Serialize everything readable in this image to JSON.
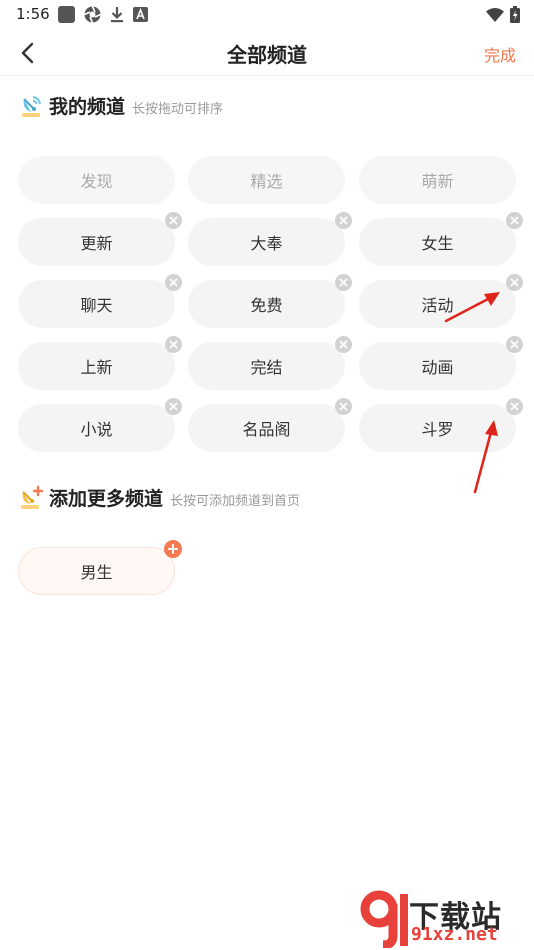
{
  "status": {
    "time": "1:56",
    "left_icons": [
      "app-square-icon",
      "aperture-icon",
      "download-icon",
      "a-box-icon"
    ],
    "right_icons": [
      "wifi-icon",
      "battery-icon"
    ]
  },
  "nav": {
    "back_icon": "chevron-left-icon",
    "title": "全部频道",
    "done_label": "完成"
  },
  "my_channels": {
    "title": "我的频道",
    "hint": "长按拖动可排序",
    "icon": "satellite-dish-icon",
    "fixed": [
      "发现",
      "精选",
      "萌新"
    ],
    "removable": [
      "更新",
      "大奉",
      "女生",
      "聊天",
      "免费",
      "活动",
      "上新",
      "完结",
      "动画",
      "小说",
      "名品阁",
      "斗罗"
    ]
  },
  "more_channels": {
    "title": "添加更多频道",
    "hint": "长按可添加频道到首页",
    "icon": "add-channel-icon",
    "items": [
      "男生"
    ]
  },
  "watermark": {
    "text": "下载站",
    "url": "91xz.net"
  },
  "colors": {
    "accent": "#f07a4c",
    "chip_bg": "#f4f4f4",
    "remove_badge": "#d2d2d2",
    "add_badge": "#f47a52",
    "arrow": "#e0241c"
  }
}
